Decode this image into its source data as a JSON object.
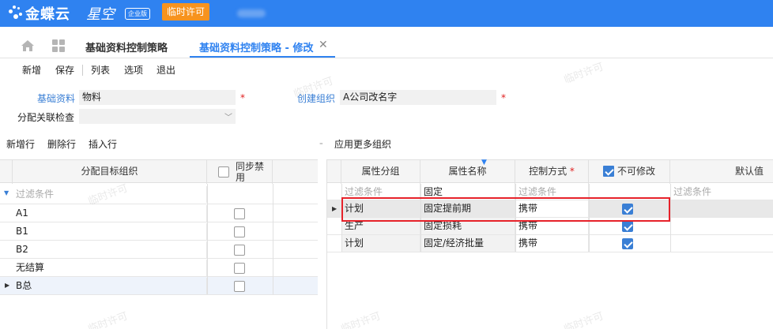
{
  "app": {
    "brand": "金蝶云",
    "brand_sub": "星空",
    "edition": "企业版",
    "trial_button": "临时许可"
  },
  "tabs": [
    {
      "label": "基础资料控制策略"
    },
    {
      "label": "基础资料控制策略 - 修改"
    }
  ],
  "toolbar": [
    "新增",
    "保存",
    "列表",
    "选项",
    "退出"
  ],
  "form": {
    "base_data_label": "基础资料",
    "base_data_value": "物料",
    "create_org_label": "创建组织",
    "create_org_value": "A公司改名字",
    "assoc_check_label": "分配关联检查",
    "assoc_check_value": "",
    "required_mark": "*"
  },
  "left_actions": [
    "新增行",
    "删除行",
    "插入行"
  ],
  "right_action": "应用更多组织",
  "left_grid": {
    "col_org": "分配目标组织",
    "col_sync": "同步禁用",
    "filter_placeholder": "过滤条件",
    "rows": [
      {
        "org": "A1",
        "sync": false
      },
      {
        "org": "B1",
        "sync": false
      },
      {
        "org": "B2",
        "sync": false
      },
      {
        "org": "无结算",
        "sync": false
      },
      {
        "org": "B总",
        "sync": false
      }
    ]
  },
  "right_grid": {
    "col_group": "属性分组",
    "col_name": "属性名称",
    "col_method": "控制方式",
    "col_nomodify": "不可修改",
    "col_default": "默认值",
    "filters": [
      "过滤条件",
      "固定",
      "过滤条件",
      "过滤条件"
    ],
    "rows": [
      {
        "group": "计划",
        "name": "固定提前期",
        "method": "携带",
        "no_modify": true
      },
      {
        "group": "生产",
        "name": "固定损耗",
        "method": "携带",
        "no_modify": true
      },
      {
        "group": "计划",
        "name": "固定/经济批量",
        "method": "携带",
        "no_modify": true
      }
    ]
  },
  "watermark_text": "临时许可",
  "colors": {
    "brand_blue": "#2f82f0",
    "trial_orange": "#f7931e",
    "highlight_red": "#e6222a"
  }
}
